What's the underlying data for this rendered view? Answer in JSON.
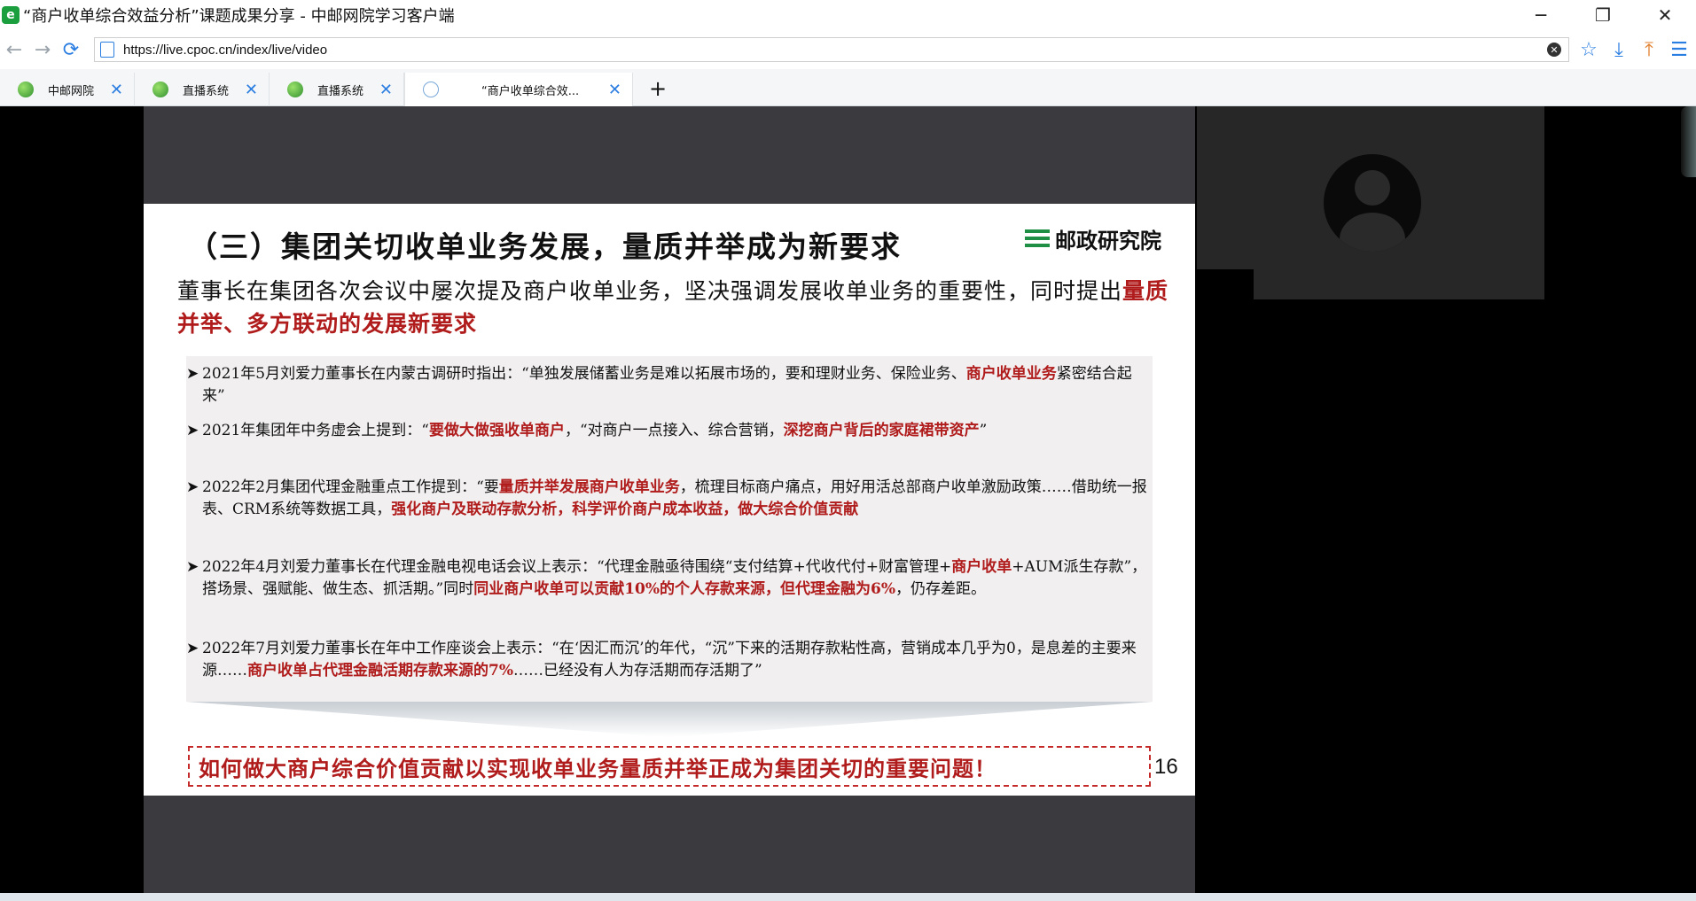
{
  "window": {
    "title": "“商户收单综合效益分析”课题成果分享 - 中邮网院学习客户端",
    "app_icon": "e",
    "controls": {
      "minimize": "─",
      "restore": "❐",
      "close": "✕"
    }
  },
  "address": {
    "url": "https://live.cpoc.cn/index/live/video",
    "back": "←",
    "forward": "→",
    "refresh": "⟳",
    "clear": "✕"
  },
  "toolbar": {
    "favorite": "☆",
    "download": "⤓",
    "share": "⤒",
    "menu": "☰"
  },
  "tabs": [
    {
      "label": "中邮网院",
      "icon": "globe-green-icon"
    },
    {
      "label": "直播系统",
      "icon": "globe-green-icon"
    },
    {
      "label": "直播系统",
      "icon": "globe-green-icon"
    },
    {
      "label": "“商户收单综合效...",
      "icon": "globe-icon"
    }
  ],
  "new_tab": "+",
  "tab_close": "✕",
  "slide": {
    "heading": "（三）集团关切收单业务发展，量质并举成为新要求",
    "logo_text": "邮政研究院",
    "lead_text": "董事长在集团各次会议中屡次提及商户收单业务，坚决强调发展收单业务的重要性，同时提出",
    "lead_highlight": "量质并举、多方联动的发展新要求",
    "arrow": "➤",
    "items": [
      {
        "t1": "2021年5月刘爱力董事长在内蒙古调研时指出：“单独发展储蓄业务是难以拓展市场的，要和理财业务、保险业务、",
        "r1": "商户收单业务",
        "t2": "紧密结合起来”"
      },
      {
        "t1": "2021年集团年中务虚会上提到：“",
        "r1": "要做大做强收单商户",
        "t2": "，“对商户一点接入、综合营销，",
        "r2": "深挖商户背后的家庭裙带资产",
        "t3": "”"
      },
      {
        "t1": "2022年2月集团代理金融重点工作提到：“要",
        "r1": "量质并举发展商户收单业务",
        "t2": "，梳理目标商户痛点，用好用活总部商户收单激励政策……借助统一报表、CRM系统等数据工具，",
        "r2": "强化商户及联动存款分析，科学评价商户成本收益，做大综合价值贡献"
      },
      {
        "t1": "2022年4月刘爱力董事长在代理金融电视电话会议上表示：“代理金融亟待围绕“支付结算+代收代付+财富管理+",
        "r1": "商户收单",
        "t2": "+AUM派生存款”，搭场景、强赋能、做生态、抓活期。”同时",
        "r2": "同业商户收单可以贡献10%的个人存款来源，但代理金融为6%",
        "t3": "，仍存差距。"
      },
      {
        "t1": "2022年7月刘爱力董事长在年中工作座谈会上表示：“在‘因汇而沉’的年代，“沉”下来的活期存款粘性高，营销成本几乎为0，是息差的主要来源……",
        "r1": "商户收单占代理金融活期存款来源的7%",
        "t2": "……已经没有人为存活期而存活期了”"
      }
    ],
    "conclusion": "如何做大商户综合价值贡献以实现收单业务量质并举正成为集团关切的重要问题！",
    "page_number": "16"
  },
  "colors": {
    "accent_red": "#b01c1c",
    "logo_green": "#1f8f45",
    "link_blue": "#2a7de1"
  }
}
